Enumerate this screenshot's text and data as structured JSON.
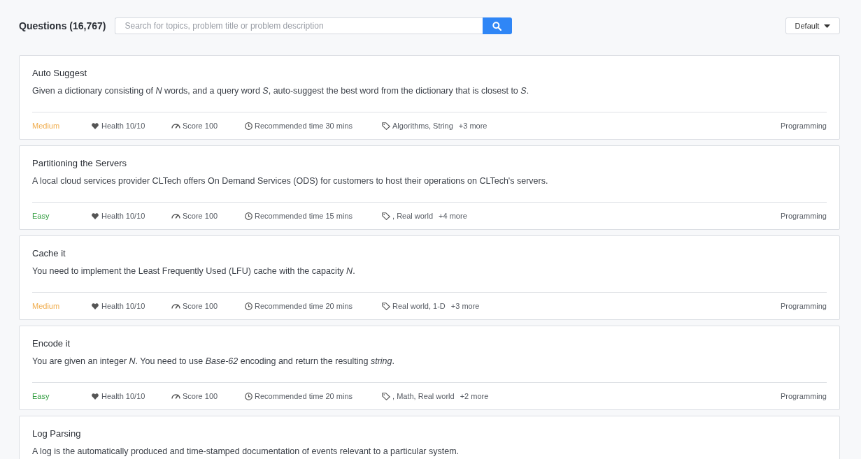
{
  "header": {
    "title": "Questions (16,767)",
    "search": {
      "placeholder": "Search for topics, problem title or problem description"
    },
    "sort": {
      "label": "Default"
    }
  },
  "questions": [
    {
      "title": "Auto Suggest",
      "description": "Given a dictionary consisting of *N* words, and a query word *S*, auto-suggest the best word from the dictionary that is closest to *S*.",
      "difficulty": {
        "label": "Medium",
        "color": "#f0ad4e"
      },
      "health": "Health 10/10",
      "score": "Score 100",
      "time": "Recommended time 30 mins",
      "tags": "Algorithms, String",
      "more": "+3 more",
      "category": "Programming"
    },
    {
      "title": "Partitioning the Servers",
      "description": "A local cloud services provider CLTech offers On Demand Services (ODS) for customers to host their operations on CLTech's servers.",
      "difficulty": {
        "label": "Easy",
        "color": "#2e9b3c"
      },
      "health": "Health 10/10",
      "score": "Score 100",
      "time": "Recommended time 15 mins",
      "tags": ", Real world",
      "more": "+4 more",
      "category": "Programming"
    },
    {
      "title": "Cache it",
      "description": "You need to implement the Least Frequently Used (LFU) cache with the capacity *N*.",
      "difficulty": {
        "label": "Medium",
        "color": "#f0ad4e"
      },
      "health": "Health 10/10",
      "score": "Score 100",
      "time": "Recommended time 20 mins",
      "tags": "Real world, 1-D",
      "more": "+3 more",
      "category": "Programming"
    },
    {
      "title": "Encode it",
      "description": "You are given an integer *N*. You need to use *Base-62* encoding and return the resulting *string*.",
      "difficulty": {
        "label": "Easy",
        "color": "#2e9b3c"
      },
      "health": "Health 10/10",
      "score": "Score 100",
      "time": "Recommended time 20 mins",
      "tags": ", Math, Real world",
      "more": "+2 more",
      "category": "Programming"
    },
    {
      "title": "Log Parsing",
      "description": "A log is the automatically produced and time-stamped documentation of events relevant to a particular system."
    }
  ]
}
